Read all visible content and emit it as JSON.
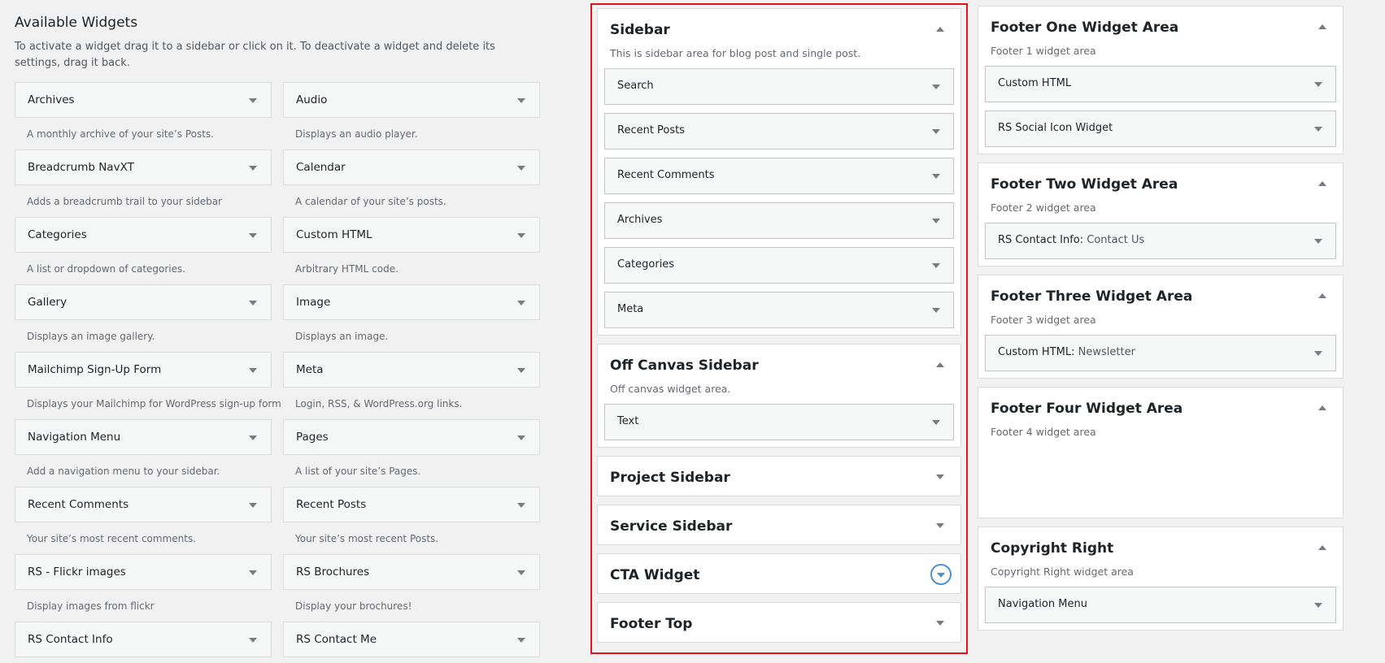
{
  "available": {
    "title": "Available Widgets",
    "intro": "To activate a widget drag it to a sidebar or click on it. To deactivate a widget and delete its settings, drag it back.",
    "widgets": [
      {
        "name": "Archives",
        "desc": "A monthly archive of your site’s Posts."
      },
      {
        "name": "Audio",
        "desc": "Displays an audio player."
      },
      {
        "name": "Breadcrumb NavXT",
        "desc": "Adds a breadcrumb trail to your sidebar"
      },
      {
        "name": "Calendar",
        "desc": "A calendar of your site’s posts."
      },
      {
        "name": "Categories",
        "desc": "A list or dropdown of categories."
      },
      {
        "name": "Custom HTML",
        "desc": "Arbitrary HTML code."
      },
      {
        "name": "Gallery",
        "desc": "Displays an image gallery."
      },
      {
        "name": "Image",
        "desc": "Displays an image."
      },
      {
        "name": "Mailchimp Sign-Up Form",
        "desc": "Displays your Mailchimp for WordPress sign-up form"
      },
      {
        "name": "Meta",
        "desc": "Login, RSS, & WordPress.org links."
      },
      {
        "name": "Navigation Menu",
        "desc": "Add a navigation menu to your sidebar."
      },
      {
        "name": "Pages",
        "desc": "A list of your site’s Pages."
      },
      {
        "name": "Recent Comments",
        "desc": "Your site’s most recent comments."
      },
      {
        "name": "Recent Posts",
        "desc": "Your site’s most recent Posts."
      },
      {
        "name": "RS - Flickr images",
        "desc": "Display images from flickr"
      },
      {
        "name": "RS Brochures",
        "desc": "Display your brochures!"
      },
      {
        "name": "RS Contact Info",
        "desc": ""
      },
      {
        "name": "RS Contact Me",
        "desc": ""
      }
    ]
  },
  "middle_areas": [
    {
      "name": "Sidebar",
      "desc": "This is sidebar area for blog post and single post.",
      "expanded": true,
      "items": [
        {
          "title": "Search",
          "sub": ""
        },
        {
          "title": "Recent Posts",
          "sub": ""
        },
        {
          "title": "Recent Comments",
          "sub": ""
        },
        {
          "title": "Archives",
          "sub": ""
        },
        {
          "title": "Categories",
          "sub": ""
        },
        {
          "title": "Meta",
          "sub": ""
        }
      ]
    },
    {
      "name": "Off Canvas Sidebar",
      "desc": "Off canvas widget area.",
      "expanded": true,
      "items": [
        {
          "title": "Text",
          "sub": ""
        }
      ]
    },
    {
      "name": "Project Sidebar",
      "expanded": false
    },
    {
      "name": "Service Sidebar",
      "expanded": false
    },
    {
      "name": "CTA Widget",
      "expanded": false,
      "focused": true
    },
    {
      "name": "Footer Top",
      "expanded": false
    }
  ],
  "right_areas": [
    {
      "name": "Footer One Widget Area",
      "desc": "Footer 1 widget area",
      "expanded": true,
      "items": [
        {
          "title": "Custom HTML",
          "sub": ""
        },
        {
          "title": "RS Social Icon Widget",
          "sub": ""
        }
      ]
    },
    {
      "name": "Footer Two Widget Area",
      "desc": "Footer 2 widget area",
      "expanded": true,
      "items": [
        {
          "title": "RS Contact Info:",
          "sub": "Contact Us"
        }
      ]
    },
    {
      "name": "Footer Three Widget Area",
      "desc": "Footer 3 widget area",
      "expanded": true,
      "items": [
        {
          "title": "Custom HTML:",
          "sub": "Newsletter"
        }
      ]
    },
    {
      "name": "Footer Four Widget Area",
      "desc": "Footer 4 widget area",
      "expanded": true,
      "items": [],
      "empty": true
    },
    {
      "name": "Copyright Right",
      "desc": "Copyright Right widget area",
      "expanded": true,
      "items": [
        {
          "title": "Navigation Menu",
          "sub": ""
        }
      ]
    }
  ],
  "colors": {
    "highlight_border": "#e3121c",
    "focus_ring": "#4a90d9"
  }
}
